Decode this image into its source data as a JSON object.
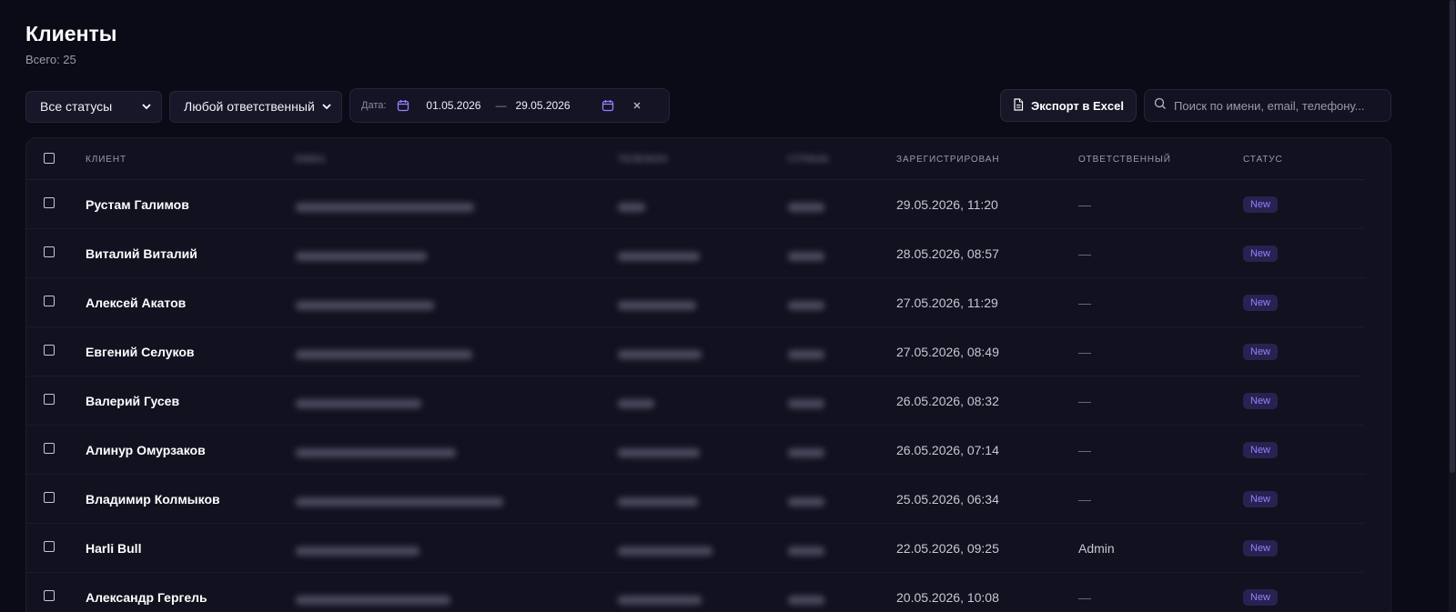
{
  "page": {
    "title": "Клиенты",
    "subtitle": "Всего: 25"
  },
  "filters": {
    "status_select": "Все статусы",
    "responsible_select": "Любой ответственный",
    "date_label": "Дата:",
    "date_from": "01.05.2026",
    "date_separator": "—",
    "date_to": "29.05.2026"
  },
  "actions": {
    "export_label": "Экспорт в Excel",
    "search_placeholder": "Поиск по имени, email, телефону..."
  },
  "table": {
    "columns": {
      "client": "КЛИЕНТ",
      "email": "EMAIL",
      "phone": "ТЕЛЕФОН",
      "country": "СТРАНА",
      "registered": "ЗАРЕГИСТРИРОВАН",
      "responsible": "ОТВЕТСТВЕННЫЙ",
      "status": "СТАТУС"
    },
    "rows": [
      {
        "name": "Рустам Галимов",
        "registered": "29.05.2026, 11:20",
        "responsible": "—",
        "status": "New"
      },
      {
        "name": "Виталий Виталий",
        "registered": "28.05.2026, 08:57",
        "responsible": "—",
        "status": "New"
      },
      {
        "name": "Алексей Акатов",
        "registered": "27.05.2026, 11:29",
        "responsible": "—",
        "status": "New"
      },
      {
        "name": "Евгений Селуков",
        "registered": "27.05.2026, 08:49",
        "responsible": "—",
        "status": "New"
      },
      {
        "name": "Валерий Гусев",
        "registered": "26.05.2026, 08:32",
        "responsible": "—",
        "status": "New"
      },
      {
        "name": "Алинур Омурзаков",
        "registered": "26.05.2026, 07:14",
        "responsible": "—",
        "status": "New"
      },
      {
        "name": "Владимир Колмыков",
        "registered": "25.05.2026, 06:34",
        "responsible": "—",
        "status": "New"
      },
      {
        "name": "Harli Bull",
        "registered": "22.05.2026, 09:25",
        "responsible": "Admin",
        "status": "New"
      },
      {
        "name": "Александр Гергель",
        "registered": "20.05.2026, 10:08",
        "responsible": "—",
        "status": "New"
      }
    ]
  },
  "colors": {
    "background": "#0b0b17",
    "accent": "#8f83ff",
    "badge_bg": "#272250"
  },
  "icons": {
    "calendar": "calendar-icon",
    "clear": "close-icon",
    "export": "file-icon",
    "search": "search-icon",
    "dropdown": "chevron-down-icon"
  }
}
